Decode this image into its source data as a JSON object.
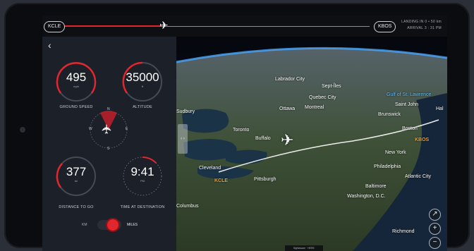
{
  "flight": {
    "origin": "KCLE",
    "destination": "KBOS",
    "landing_in": "LANDING IN 0 • 50 km",
    "arrival": "ARRIVAL 3 : 31 PM",
    "progress": 0.36
  },
  "panel": {
    "back_icon": "chevron-left-icon",
    "ground_speed": {
      "value": "495",
      "unit": "mph",
      "label": "GROUND SPEED"
    },
    "altitude": {
      "value": "35000",
      "unit": "ft",
      "label": "ALTITUDE"
    },
    "distance": {
      "value": "377",
      "unit": "mi",
      "label": "DISTANCE TO GO"
    },
    "time": {
      "value": "9:41",
      "unit": "PM",
      "label": "TIME AT DESTINATION"
    },
    "compass_letters": {
      "n": "N",
      "e": "E",
      "s": "S",
      "w": "W"
    },
    "units_toggle": {
      "left": "KM",
      "right": "MILES",
      "selected": "MILES"
    }
  },
  "map": {
    "cities": [
      {
        "name": "Labrador City"
      },
      {
        "name": "Sept-Îles"
      },
      {
        "name": "Quebec City"
      },
      {
        "name": "Gulf of St. Lawrence"
      },
      {
        "name": "Sudbury"
      },
      {
        "name": "Ottawa"
      },
      {
        "name": "Montreal"
      },
      {
        "name": "Saint John"
      },
      {
        "name": "Hal"
      },
      {
        "name": "Brunswick"
      },
      {
        "name": "Toronto"
      },
      {
        "name": "Buffalo"
      },
      {
        "name": "Boston"
      },
      {
        "name": "New York"
      },
      {
        "name": "Cleveland"
      },
      {
        "name": "Pittsburgh"
      },
      {
        "name": "Philadelphia"
      },
      {
        "name": "Atlantic City"
      },
      {
        "name": "Baltimore"
      },
      {
        "name": "Washington, D.C."
      },
      {
        "name": "Columbus"
      },
      {
        "name": "Richmond"
      }
    ],
    "airports": {
      "origin": "KCLE",
      "destination": "KBOS"
    },
    "panel_handle": "‹ ›",
    "credit": "flightaware · HERE",
    "controls": {
      "compass": "↗",
      "zoom_in": "+",
      "zoom_out": "−"
    }
  }
}
